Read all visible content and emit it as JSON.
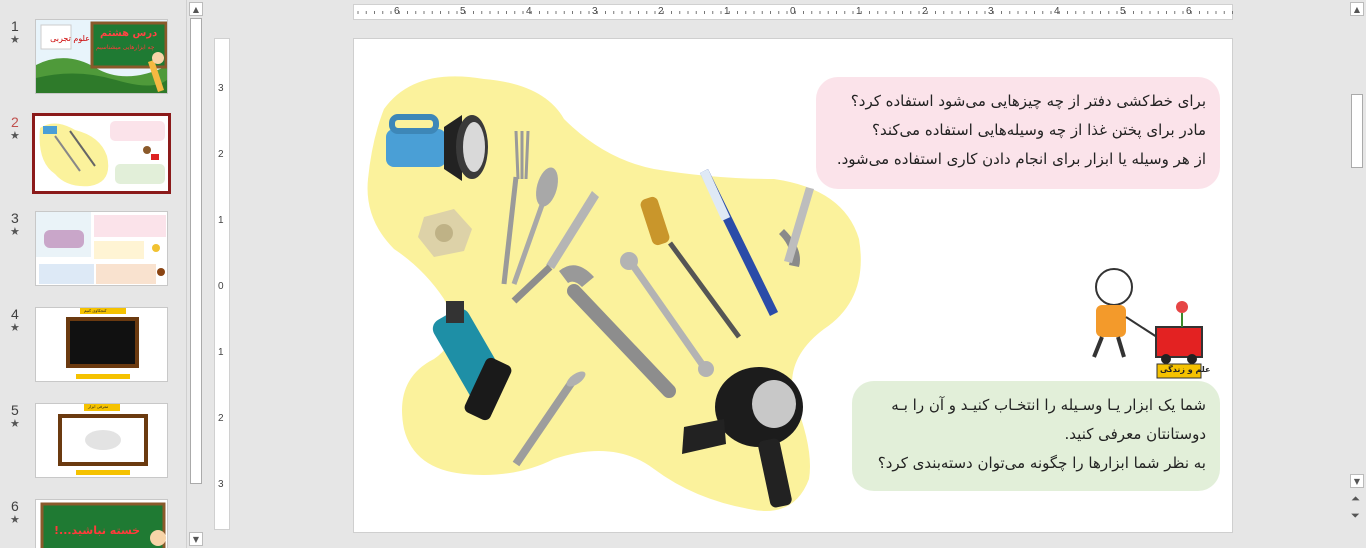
{
  "thumbnails": [
    {
      "number": "1",
      "star": "★",
      "title_text": "درس هشتم",
      "subtitle_text": "چه ابزارهایی میشناسیم"
    },
    {
      "number": "2",
      "star": "★"
    },
    {
      "number": "3",
      "star": "★"
    },
    {
      "number": "4",
      "star": "★",
      "banner_text": "کنجکاوی کنیم"
    },
    {
      "number": "5",
      "star": "★",
      "banner_text": "معرفی ابزار"
    },
    {
      "number": "6",
      "star": "★",
      "title_text": "خسته نباشید...!"
    }
  ],
  "ruler": {
    "horizontal": [
      "6",
      "5",
      "4",
      "3",
      "2",
      "1",
      "0",
      "1",
      "2",
      "3",
      "4",
      "5",
      "6"
    ],
    "vertical": [
      "3",
      "2",
      "1",
      "0",
      "1",
      "2",
      "3"
    ]
  },
  "slide": {
    "question_lines": [
      "برای خط‌کشی دفتر از چه چیزهایی می‌شود استفاده کرد؟",
      "مادر برای پختن غذا از چه وسیله‌هایی استفاده می‌کند؟",
      "از هر وسیله یا ابزار برای انجام دادن کاری استفاده می‌شود."
    ],
    "activity_lines": [
      "شما یک ابزار یـا وسـیله را انتخـاب کنیـد و آن را بـه",
      "دوستانتان معرفی کنید.",
      "به نظر شما ابزارها را چگونه می‌توان دسته‌بندی کرد؟"
    ],
    "logo_text": "علم و زندگی"
  },
  "colors": {
    "active_slide_border": "#8b1a1a",
    "blob_fill": "#fbf29c",
    "pink_bubble": "#fbe3ea",
    "green_bubble": "#e2efd9"
  },
  "icons": [
    "flashlight-icon",
    "fork-icon",
    "spoon-icon",
    "knife-icon",
    "screwdriver-icon",
    "toothbrush-icon",
    "nail-clipper-icon",
    "nut-icon",
    "drill-icon",
    "wrench-icon",
    "spanner-icon",
    "screw-icon",
    "hair-dryer-icon",
    "child-with-cart-icon"
  ]
}
